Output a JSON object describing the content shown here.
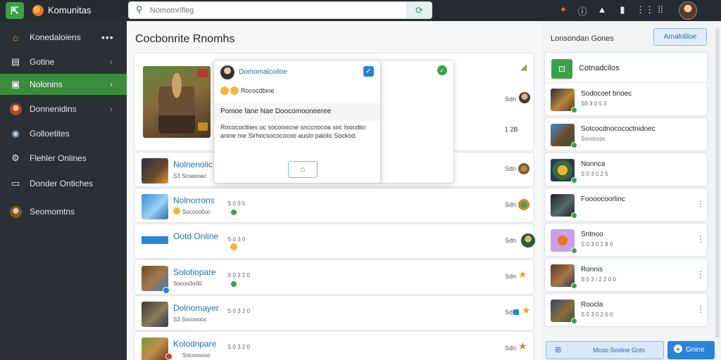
{
  "app": {
    "title": "Komunitas"
  },
  "search": {
    "placeholder": "Nomomrifleg"
  },
  "sidebar": {
    "items": [
      {
        "label": "Konedaloiens",
        "icon": "home-icon"
      },
      {
        "label": "Gotine",
        "icon": "list-icon"
      },
      {
        "label": "Nolonins",
        "icon": "book-icon",
        "active": true
      },
      {
        "label": "Donnenidins",
        "icon": "avatar-icon"
      },
      {
        "label": "Golloetites",
        "icon": "chat-icon"
      },
      {
        "label": "Flehler Onlines",
        "icon": "gear-icon"
      },
      {
        "label": "Donder Ontiches",
        "icon": "note-icon"
      },
      {
        "label": "Seomomtns",
        "icon": "avatar-icon"
      }
    ]
  },
  "main": {
    "title": "Cocbonrite Rnomhs",
    "featured": {
      "right_a": "Sdn",
      "right_b": "1 2B"
    },
    "rows": [
      {
        "title": "Nolnenolic",
        "sub": "S3 Scoaooac",
        "right": "Sdn"
      },
      {
        "title": "Nolnorrons",
        "meta": "S 0 3 5",
        "sub": "Socooo0oc",
        "right": "Sdn"
      },
      {
        "title": "Ootd Online",
        "meta": "S 0 3 0",
        "sub": "",
        "right": "Sdn"
      },
      {
        "title": "Solotiopare",
        "meta": "S 0 3 2 0",
        "sub": "Socoo3o00",
        "right": "Sdn"
      },
      {
        "title": "Dolnomayer",
        "meta": "S 0 3 2 0",
        "sub": "S3 Socooooc",
        "right": "Sdn"
      },
      {
        "title": "Kolodnpare",
        "meta": "S 0 3 2 0",
        "sub": "Socoooooc",
        "right": "Sdn"
      }
    ]
  },
  "popup": {
    "name": "Domomalcoiloe",
    "reaction": "Rococdbine",
    "heading": "Pomoe fane Nae Doocomooneeree",
    "body": "Rocococtiiies oc socooocne snccnocoa soc Isocdiio anine me Sirhocsocococoo auslo palolo Sockod.",
    "button_icon": "home-icon"
  },
  "right_panel": {
    "title": "Lonsondan Gones",
    "action_button": "Arnaloliloe",
    "header_label": "Cotnadcilos",
    "items": [
      {
        "name": "Sodocoet bnoec",
        "meta": "S0 3 0 5 3"
      },
      {
        "name": "Sotcocdnocococtnidoec",
        "meta": "Sococcoc"
      },
      {
        "name": "Nonnca",
        "meta": "S 0 3 0 2 5"
      },
      {
        "name": "Foooocoorlinc",
        "meta": ""
      },
      {
        "name": "Sntnoo",
        "meta": "S 0 3 0 2 8 0"
      },
      {
        "name": "Ronnis",
        "meta": "S 0 3 / 2 2 0 0"
      },
      {
        "name": "Roocla",
        "meta": "S 0 3 0 2 0 0"
      }
    ],
    "footer_secondary": "Mcoo Sooloe Gnts",
    "footer_primary": "Gnine"
  },
  "colors": {
    "accent_green": "#3aa14a",
    "accent_blue": "#2784d8",
    "sidebar_bg": "#2b3036",
    "topbar_bg": "#262b31"
  }
}
